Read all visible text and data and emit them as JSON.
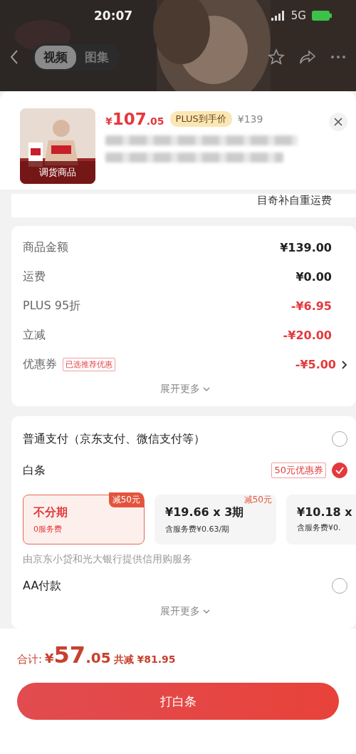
{
  "status_bar": {
    "time": "20:07",
    "network": "5G"
  },
  "header": {
    "tabs": [
      {
        "label": "视频",
        "selected": true
      },
      {
        "label": "图集",
        "selected": false
      }
    ]
  },
  "product": {
    "thumbnail_label": "调货商品",
    "price_symbol": "¥",
    "price_int": "107",
    "price_dec": ".05",
    "plus_badge": "PLUS到手价",
    "original_price": "¥139"
  },
  "shipping_note": "目奇补自重运费",
  "summary": {
    "rows": [
      {
        "label": "商品金额",
        "value": "¥139.00",
        "kind": "normal"
      },
      {
        "label": "运费",
        "value": "¥0.00",
        "kind": "normal"
      },
      {
        "label": "PLUS 95折",
        "value": "-¥6.95",
        "kind": "discount"
      },
      {
        "label": "立减",
        "value": "-¥20.00",
        "kind": "discount"
      },
      {
        "label": "优惠券",
        "tag": "已选推荐优惠",
        "value": "-¥5.00",
        "kind": "discount",
        "link": true
      }
    ],
    "expand": "展开更多"
  },
  "payment": {
    "methods": [
      {
        "label": "普通支付（京东支付、微信支付等）",
        "selected": false
      },
      {
        "label": "白条",
        "tag": "50元优惠券",
        "selected": true,
        "installments": [
          {
            "title": "不分期",
            "subtitle": "0服务费",
            "badge": "减50元",
            "selected": true
          },
          {
            "title": "¥19.66 x 3期",
            "subtitle": "含服务费¥0.63/期",
            "badge": "减50元",
            "selected": false
          },
          {
            "title": "¥10.18 x",
            "subtitle": "含服务费¥0.",
            "selected": false
          }
        ],
        "note": "由京东小贷和光大银行提供信用购服务"
      },
      {
        "label": "AA付款",
        "selected": false
      }
    ],
    "expand": "展开更多"
  },
  "footer": {
    "total_label": "合计:",
    "total_symbol": "¥",
    "total_int": "57",
    "total_dec": ".05",
    "saved": "共减 ¥81.95",
    "button": "打白条"
  }
}
